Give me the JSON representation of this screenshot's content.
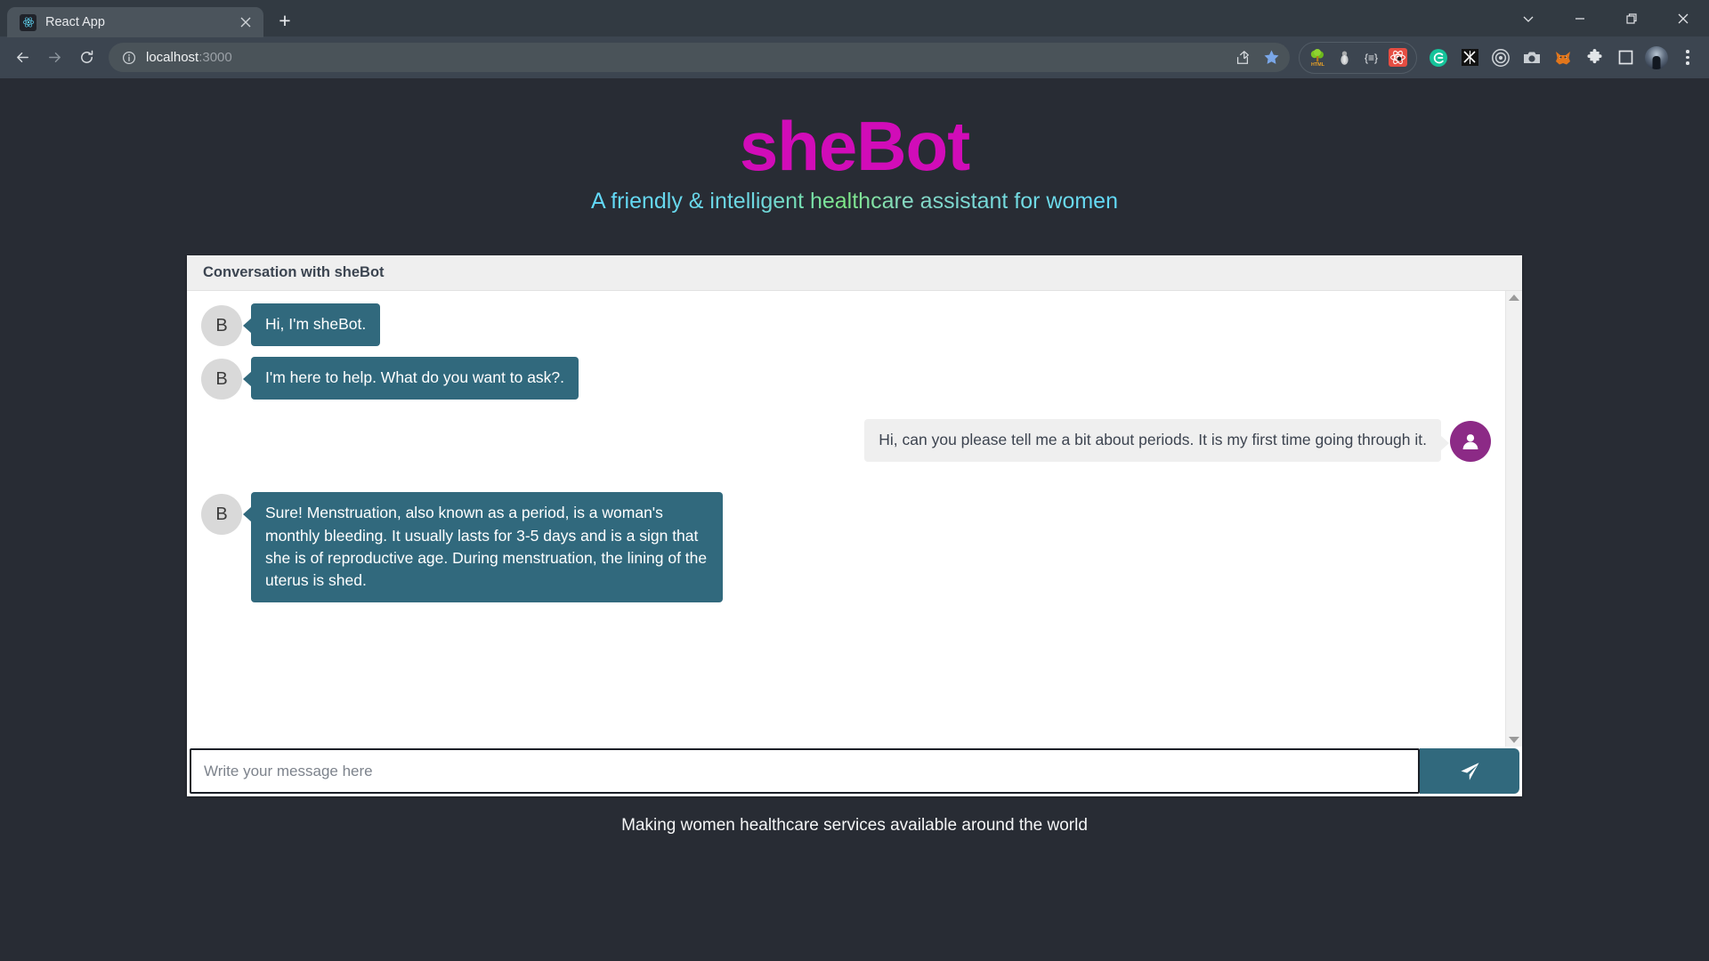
{
  "browser": {
    "tab": {
      "title": "React App",
      "favicon_icon": "react-logo-icon",
      "close_icon": "close-icon"
    },
    "new_tab_label": "+",
    "window_controls": [
      {
        "name": "chevron-down-icon",
        "label": "∨"
      },
      {
        "name": "minimize-icon",
        "label": "—"
      },
      {
        "name": "restore-icon",
        "label": "❐"
      },
      {
        "name": "close-window-icon",
        "label": "✕"
      }
    ],
    "nav": {
      "back_icon": "back-arrow-icon",
      "forward_icon": "forward-arrow-icon",
      "reload_icon": "reload-icon"
    },
    "omnibox": {
      "info_icon": "site-info-icon",
      "url_host": "localhost",
      "url_port": ":3000",
      "share_icon": "share-icon",
      "bookmark_icon": "bookmark-star-icon"
    },
    "extensions": [
      {
        "name": "html-tree-extension-icon",
        "glyph": "🌳",
        "label": "HTML"
      },
      {
        "name": "bug-extension-icon",
        "glyph": "",
        "label": ""
      },
      {
        "name": "json-viewer-extension-icon",
        "glyph": "{≡}",
        "label": ""
      },
      {
        "name": "react-devtools-extension-icon",
        "glyph": "",
        "label": ""
      }
    ],
    "pinned_icons": [
      {
        "name": "grammarly-icon",
        "glyph": "G"
      },
      {
        "name": "x-marks-extension-icon",
        "glyph": ""
      },
      {
        "name": "target-recorder-icon",
        "glyph": ""
      },
      {
        "name": "screenshot-camera-icon",
        "glyph": ""
      },
      {
        "name": "metamask-fox-icon",
        "glyph": ""
      }
    ],
    "toolbar_right": [
      {
        "name": "extensions-puzzle-icon"
      },
      {
        "name": "side-panel-icon"
      },
      {
        "name": "profile-avatar"
      },
      {
        "name": "chrome-menu-icon"
      }
    ]
  },
  "app": {
    "title": "sheBot",
    "subtitle": "A friendly & intelligent healthcare assistant for women",
    "footer": "Making women healthcare services available around the world",
    "accent_magenta": "#d10cb8",
    "accent_teal": "#31697d",
    "accent_purple": "#8c2a86",
    "page_background": "#282c34"
  },
  "chat": {
    "header_title": "Conversation with sheBot",
    "bot_avatar_initial": "B",
    "user_avatar_icon": "person-icon",
    "messages": [
      {
        "sender": "bot",
        "text": "Hi, I'm sheBot."
      },
      {
        "sender": "bot",
        "text": "I'm here to help. What do you want to ask?."
      },
      {
        "sender": "user",
        "text": "Hi, can you please tell me a bit about periods. It is my first time going through it."
      },
      {
        "sender": "bot",
        "text": "Sure! Menstruation, also known as a period, is a woman's monthly bleeding. It usually lasts for 3-5 days and is a sign that she is of reproductive age. During menstruation, the lining of the uterus is shed."
      }
    ],
    "scrollbar": {
      "up_icon": "scroll-up-arrow-icon",
      "down_icon": "scroll-down-arrow-icon"
    }
  },
  "composer": {
    "placeholder": "Write your message here",
    "value": "",
    "send_icon": "send-paper-plane-icon"
  }
}
